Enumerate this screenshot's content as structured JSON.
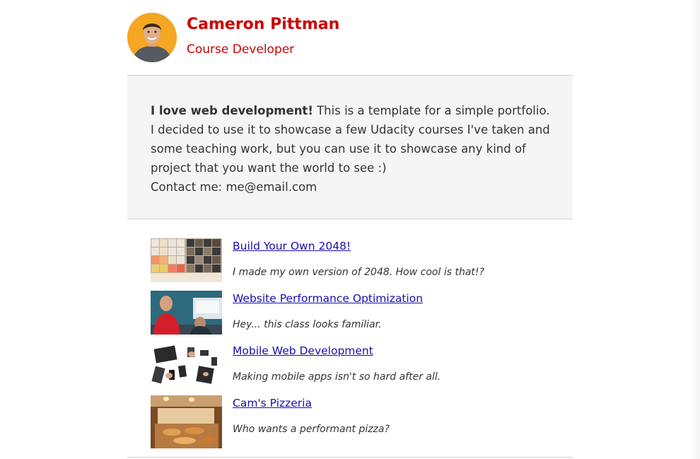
{
  "profile": {
    "name": "Cameron Pittman",
    "role": "Course Developer"
  },
  "about": {
    "bold_intro": "I love web development!",
    "text": " This is a template for a simple portfolio. I decided to use it to showcase a few Udacity courses I've taken and some teaching work, but you can use it to showcase any kind of project that you want the world to see :)",
    "contact": "Contact me: me@email.com"
  },
  "projects": [
    {
      "title": "Build Your Own 2048!",
      "description": "I made my own version of 2048. How cool is that!?"
    },
    {
      "title": "Website Performance Optimization",
      "description": "Hey... this class looks familiar."
    },
    {
      "title": "Mobile Web Development",
      "description": "Making mobile apps isn't so hard after all."
    },
    {
      "title": "Cam's Pizzeria",
      "description": "Who wants a performant pizza?"
    }
  ],
  "colors": {
    "accent": "#cc0000",
    "link": "#1a0dab",
    "panel": "#f4f5f4"
  }
}
